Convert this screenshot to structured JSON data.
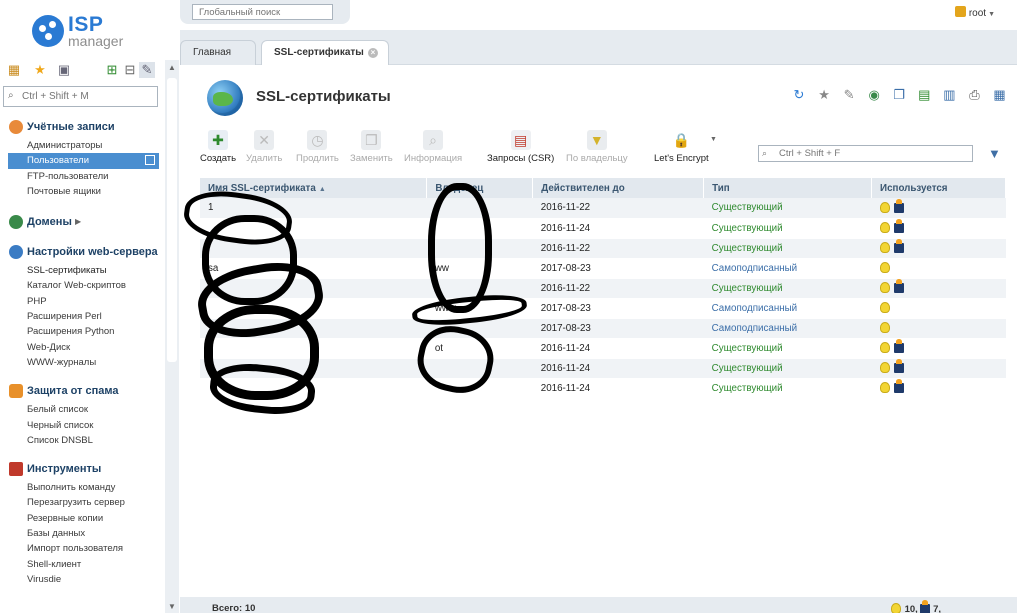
{
  "app": {
    "logo_isp": "ISP",
    "logo_manager": "manager"
  },
  "global_search": {
    "placeholder": "Глобальный поиск"
  },
  "user": {
    "name": "root"
  },
  "side_search": {
    "placeholder": "Ctrl + Shift + M"
  },
  "menu": {
    "accounts": {
      "title": "Учётные записи",
      "items": [
        "Администраторы",
        "Пользователи",
        "FTP-пользователи",
        "Почтовые ящики"
      ]
    },
    "domains": {
      "title": "Домены"
    },
    "webserver": {
      "title": "Настройки web-сервера",
      "items": [
        "SSL-сертификаты",
        "Каталог Web-скриптов",
        "PHP",
        "Расширения Perl",
        "Расширения Python",
        "Web-Диск",
        "WWW-журналы"
      ]
    },
    "spam": {
      "title": "Защита от спама",
      "items": [
        "Белый список",
        "Черный список",
        "Список DNSBL"
      ]
    },
    "tools": {
      "title": "Инструменты",
      "items": [
        "Выполнить команду",
        "Перезагрузить сервер",
        "Резервные копии",
        "Базы данных",
        "Импорт пользователя",
        "Shell-клиент",
        "Virusdie"
      ]
    }
  },
  "tabs": {
    "home": "Главная",
    "current": "SSL-сертификаты"
  },
  "page": {
    "title": "SSL-сертификаты"
  },
  "toolbar": {
    "create": "Создать",
    "delete": "Удалить",
    "extend": "Продлить",
    "replace": "Заменить",
    "info": "Информация",
    "csr": "Запросы (CSR)",
    "by_owner": "По владельцу",
    "letsencrypt": "Let's Encrypt"
  },
  "table_search": {
    "placeholder": "Ctrl + Shift + F"
  },
  "table": {
    "columns": {
      "name": "Имя SSL-сертификата",
      "owner": "Владелец",
      "valid": "Действителен до",
      "type": "Тип",
      "used": "Используется"
    },
    "rows": [
      {
        "name": "1",
        "owner": "",
        "valid": "2016-11-22",
        "type": "Существующий",
        "le": true
      },
      {
        "name": "",
        "owner": "",
        "valid": "2016-11-24",
        "type": "Существующий",
        "le": true
      },
      {
        "name": "",
        "owner": "",
        "valid": "2016-11-22",
        "type": "Существующий",
        "le": true
      },
      {
        "name": "sa",
        "owner": "ww",
        "valid": "2017-08-23",
        "type": "Самоподписанный",
        "le": false
      },
      {
        "name": "",
        "owner": "",
        "valid": "2016-11-22",
        "type": "Существующий",
        "le": true
      },
      {
        "name": "",
        "owner": "www",
        "valid": "2017-08-23",
        "type": "Самоподписанный",
        "le": false
      },
      {
        "name": "",
        "owner": "",
        "valid": "2017-08-23",
        "type": "Самоподписанный",
        "le": false
      },
      {
        "name": "",
        "owner": "ot",
        "valid": "2016-11-24",
        "type": "Существующий",
        "le": true
      },
      {
        "name": "",
        "owner": "",
        "valid": "2016-11-24",
        "type": "Существующий",
        "le": true
      },
      {
        "name": "",
        "owner": "",
        "valid": "2016-11-24",
        "type": "Существующий",
        "le": true
      }
    ]
  },
  "footer": {
    "total": "Всего: 10",
    "bulb_count": "10,",
    "le_count": "7,"
  }
}
